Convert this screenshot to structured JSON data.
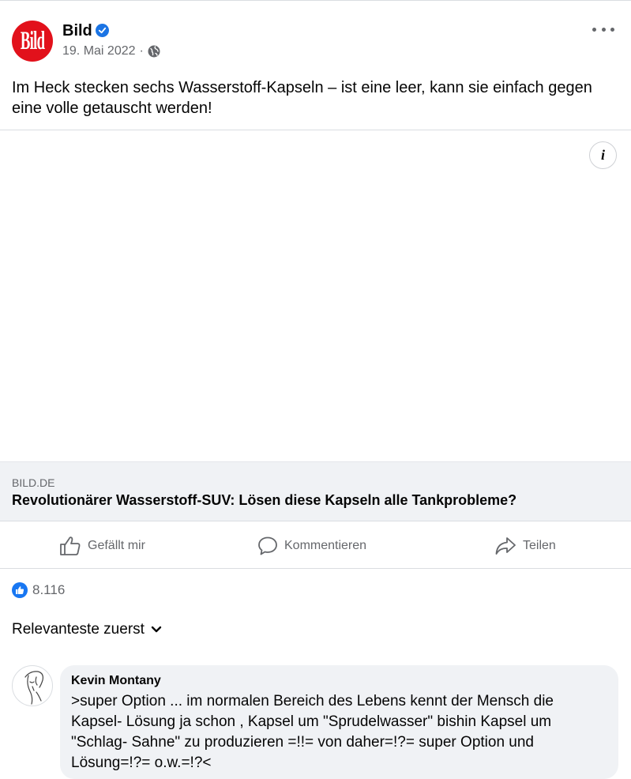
{
  "post": {
    "page_name": "Bild",
    "logo_text": "Bild",
    "date": "19. Mai 2022",
    "separator": "·",
    "text": "Im Heck stecken sechs Wasserstoff-Kapseln – ist eine leer, kann sie einfach gegen eine volle getauscht werden!"
  },
  "link": {
    "domain": "BILD.DE",
    "title": "Revolutionärer Wasserstoff-SUV: Lösen diese Kapseln alle Tankprobleme?"
  },
  "info_button": {
    "glyph": "i"
  },
  "actions": {
    "like_label": "Gefällt mir",
    "comment_label": "Kommentieren",
    "share_label": "Teilen"
  },
  "reactions": {
    "count": "8.116"
  },
  "sort": {
    "label": "Relevanteste zuerst"
  },
  "comments": [
    {
      "author": "Kevin Montany",
      "text": ">super Option ... im normalen Bereich des Lebens kennt der Mensch die Kapsel- Lösung ja schon , Kapsel um \"Sprudelwasser\" bishin Kapsel um \"Schlag- Sahne\" zu produzieren =!!= von daher=!?= super Option und Lösung=!?= o.w.=!?<"
    }
  ],
  "colors": {
    "accent": "#1877f2",
    "verified": "#1b74e4",
    "logo_red": "#e2111b",
    "secondary_text": "#65676b",
    "bubble_bg": "#f0f2f5"
  },
  "icons": [
    "bild-logo",
    "verified-icon",
    "globe-icon",
    "more-icon",
    "info-icon",
    "like-icon",
    "comment-icon",
    "share-icon",
    "like-reaction-icon",
    "chevron-down-icon"
  ]
}
